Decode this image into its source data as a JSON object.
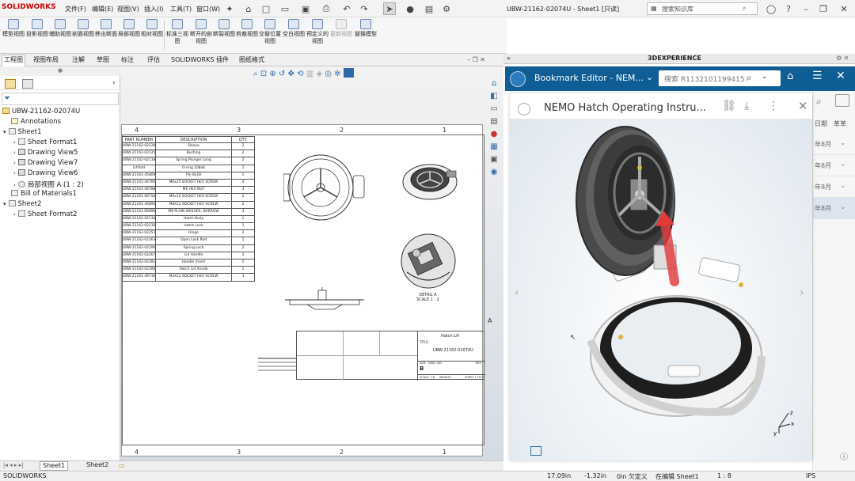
{
  "app": {
    "brand": "SOLIDWORKS",
    "menus": [
      "文件(F)",
      "编辑(E)",
      "视图(V)",
      "插入(I)",
      "工具(T)",
      "窗口(W)"
    ],
    "window_title": "UBW-21162-02074U - Sheet1 [只读]",
    "search_placeholder": "搜索知识库"
  },
  "ribbon": {
    "buttons": [
      {
        "label": "模型视图"
      },
      {
        "label": "投影视图"
      },
      {
        "label": "辅助视图"
      },
      {
        "label": "剖面视图"
      },
      {
        "label": "移出断面"
      },
      {
        "label": "局部视图"
      },
      {
        "label": "相对视图"
      },
      {
        "label": "标准三视图"
      },
      {
        "label": "断开的剖视图"
      },
      {
        "label": "断裂视图"
      },
      {
        "label": "剪裁视图"
      },
      {
        "label": "交替位置视图"
      },
      {
        "label": "空白视图"
      },
      {
        "label": "预定义的视图"
      },
      {
        "label": "更新视图"
      },
      {
        "label": "替换模型"
      }
    ]
  },
  "tabs": [
    "工程图",
    "视图布局",
    "注解",
    "草图",
    "标注",
    "评估",
    "SOLIDWORKS 插件",
    "图纸格式"
  ],
  "tree": {
    "root": "UBW-21162-02074U",
    "items": [
      "Annotations",
      "Sheet1",
      "Sheet Format1",
      "Drawing View5",
      "Drawing View7",
      "Drawing View6",
      "局部视图 A (1 : 2)",
      "Bill of Materials1",
      "Sheet2",
      "Sheet Format2"
    ]
  },
  "drawing": {
    "zones_top": [
      "4",
      "3",
      "2",
      "1"
    ],
    "zones_bottom": [
      "4",
      "3",
      "2",
      "1"
    ],
    "zone_letter": "A",
    "bom_headers": [
      "PART NUMBER",
      "DESCRIPTION",
      "QTY."
    ],
    "bom_rows": [
      [
        "UBW-21162-02120U",
        "Sleeve",
        "2"
      ],
      [
        "UBW-21162-02125U",
        "Bushing",
        "2"
      ],
      [
        "UBW-21162-02118U",
        "Spring Plunger Long",
        "2"
      ],
      [
        "Ichfold",
        "O-ring 108x6",
        "1"
      ],
      [
        "UBW-21161-45809U",
        "Pin 8x18",
        "1"
      ],
      [
        "UBW-21161-44785U",
        "M6x25 SOCKET HEX SCREW",
        "4"
      ],
      [
        "UBW-21161-44788U",
        "M6 HEX NUT",
        "3"
      ],
      [
        "UBW-21161-66758U",
        "M8x16 SOCKET HEX SCREW",
        "2"
      ],
      [
        "UBW-21161-44894U",
        "M8X12 SOCKET HEX SCREW",
        "2"
      ],
      [
        "UBW-21161-66896GU",
        "M8 PLAIN WASHER, NARROW",
        "3"
      ],
      [
        "UBW-21162-02138U",
        "Hatch Body",
        "1"
      ],
      [
        "UBW-21162-02135U",
        "Hatch Lock",
        "1"
      ],
      [
        "UBW-21162-02253U",
        "Hinge",
        "2"
      ],
      [
        "UBW-21162-02263U",
        "Open Lock Rod",
        "1"
      ],
      [
        "UBW-21162-02290U",
        "Spring Lock",
        "2"
      ],
      [
        "UBW-21162-02267U",
        "Lid Handle",
        "1"
      ],
      [
        "UBW-21162-02281U",
        "Handle Insert",
        "2"
      ],
      [
        "UBW-21162-02280U",
        "Hatch Lid Anode",
        "1"
      ],
      [
        "UBW-21161-46716U",
        "M4X12 SOCKET HEX SCREW",
        "3"
      ]
    ],
    "detail_label": "DETAIL A",
    "detail_scale": "SCALE 1 : 2",
    "title_name": "Hatch LH",
    "title_dwg_no": "UBW-21162-02074U",
    "title_size": "B",
    "title_field_title": "TITLE:",
    "title_field_size": "SIZE",
    "title_field_dwgno": "DWG. NO.",
    "title_field_rev": "REV",
    "title_scale": "SCALE: 1:8",
    "title_weight": "WEIGHT:",
    "title_sheet": "SHEET 1 OF 2"
  },
  "sheet_tabs": [
    "Sheet1",
    "Sheet2"
  ],
  "experience": {
    "header": "3DEXPERIENCE",
    "bookmark_title": "Bookmark Editor - NEM...",
    "search_placeholder": "搜索 R1132101199415",
    "card_title": "NEMO Hatch Operating Instru...",
    "side_header_a": "日期",
    "side_header_b": "革革",
    "side_rows": [
      "年8月",
      "年8月",
      "年8月",
      "年8月"
    ]
  },
  "status": {
    "app": "SOLIDWORKS",
    "x": "17.09in",
    "y": "-1.32in",
    "z": "0in 欠定义",
    "mode": "在编辑 Sheet1",
    "scale": "1 : 8",
    "units": "IPS"
  },
  "colors": {
    "brand_red": "#d10000",
    "exp_blue": "#0f5d95",
    "hatch_red": "#e23a3a"
  }
}
